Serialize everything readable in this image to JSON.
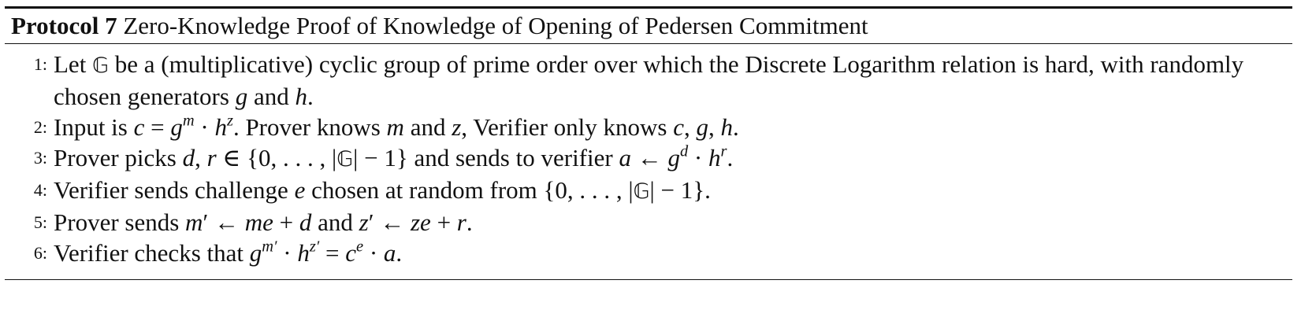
{
  "algorithm": {
    "label": "Protocol 7",
    "title": "Zero-Knowledge Proof of Knowledge of Opening of Pedersen Commitment",
    "steps": [
      {
        "num": "1:",
        "text": "Let 𝔾 be a (multiplicative) cyclic group of prime order over which the Discrete Logarithm relation is hard, with randomly chosen generators g and h."
      },
      {
        "num": "2:",
        "text": "Input is c = gᵐ · hᶻ. Prover knows m and z, Verifier only knows c, g, h."
      },
      {
        "num": "3:",
        "text": "Prover picks d, r ∈ {0, . . . , |𝔾| − 1} and sends to verifier a ← gᵈ · hʳ."
      },
      {
        "num": "4:",
        "text": "Verifier sends challenge e chosen at random from {0, . . . , |𝔾| − 1}."
      },
      {
        "num": "5:",
        "text": "Prover sends m′ ← me + d and z′ ← ze + r."
      },
      {
        "num": "6:",
        "text": "Verifier checks that g^(m′) · h^(z′) = cᵉ · a."
      }
    ]
  }
}
